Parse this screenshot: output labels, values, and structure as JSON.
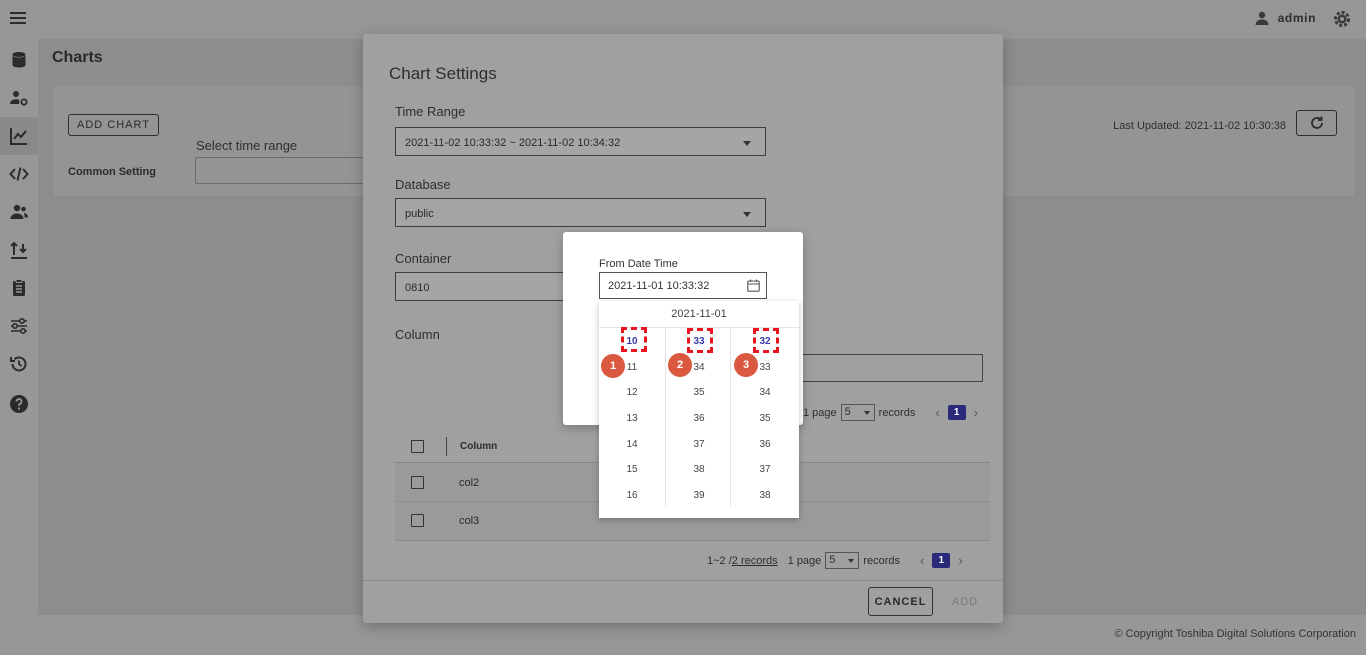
{
  "topbar": {
    "user": "admin"
  },
  "page": {
    "title": "Charts",
    "add_chart": "ADD CHART",
    "common_setting": "Common Setting",
    "time_range_label": "Select time range",
    "last_updated": "Last Updated: 2021-11-02 10:30:38"
  },
  "sidebar": {
    "items": [
      {
        "icon": "database-icon"
      },
      {
        "icon": "user-settings-icon"
      },
      {
        "icon": "chart-line-icon"
      },
      {
        "icon": "code-icon"
      },
      {
        "icon": "users-icon"
      },
      {
        "icon": "import-export-icon"
      },
      {
        "icon": "clipboard-icon"
      },
      {
        "icon": "sliders-icon"
      },
      {
        "icon": "history-icon"
      },
      {
        "icon": "help-icon"
      }
    ]
  },
  "dialog": {
    "title": "Chart Settings",
    "time_range_label": "Time Range",
    "time_range_value": "2021-11-02 10:33:32 ~ 2021-11-02 10:34:32",
    "database_label": "Database",
    "database_value": "public",
    "container_label": "Container",
    "container_value": "0810",
    "column_label": "Column",
    "pager_top": {
      "pages": "1 page",
      "size": "5",
      "records_word": "records",
      "current": "1"
    },
    "table": {
      "header": "Column",
      "rows": [
        "col2",
        "col3"
      ]
    },
    "pager_bottom": {
      "range": "1~2 / ",
      "records_link": "2 records",
      "pages": "1 page",
      "size": "5",
      "records_word": "records",
      "current": "1"
    },
    "cancel": "CANCEL",
    "add": "ADD"
  },
  "popup": {
    "label": "From Date Time",
    "value": "2021-11-01 10:33:32",
    "picker_date": "2021-11-01",
    "hours": [
      "10",
      "11",
      "12",
      "13",
      "14",
      "15",
      "16"
    ],
    "minutes": [
      "33",
      "34",
      "35",
      "36",
      "37",
      "38",
      "39"
    ],
    "seconds": [
      "32",
      "33",
      "34",
      "35",
      "36",
      "37",
      "38"
    ],
    "badges": [
      "1",
      "2",
      "3"
    ]
  },
  "footer": {
    "copyright": "© Copyright Toshiba Digital Solutions Corporation"
  }
}
